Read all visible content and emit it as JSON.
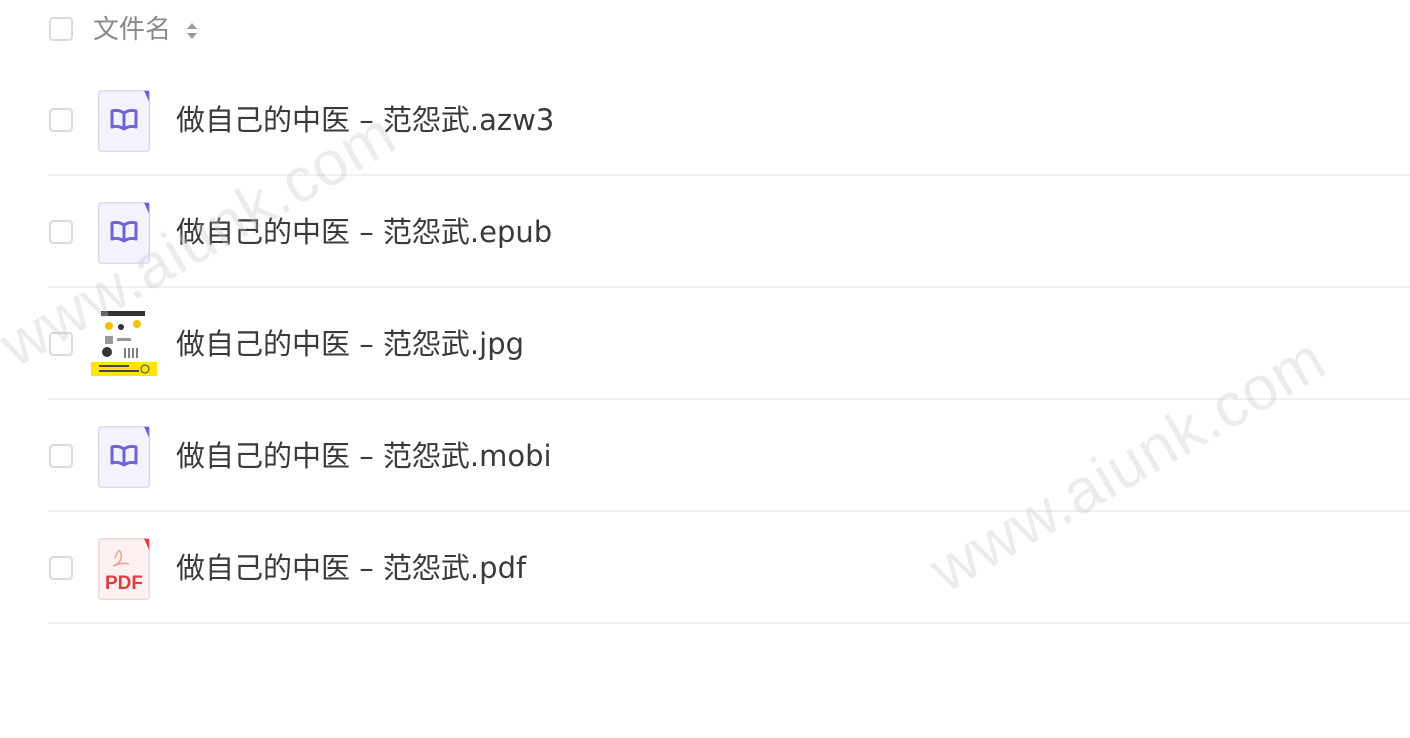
{
  "header": {
    "column_label": "文件名"
  },
  "files": [
    {
      "name": "做自己的中医 – 范怨武.azw3",
      "icon": "ebook-icon"
    },
    {
      "name": "做自己的中医 – 范怨武.epub",
      "icon": "ebook-icon"
    },
    {
      "name": "做自己的中医 – 范怨武.jpg",
      "icon": "image-thumbnail"
    },
    {
      "name": "做自己的中医 – 范怨武.mobi",
      "icon": "ebook-icon"
    },
    {
      "name": "做自己的中医 – 范怨武.pdf",
      "icon": "pdf-icon",
      "icon_text": "PDF"
    }
  ],
  "watermark": "www.aiunk.com",
  "colors": {
    "ebook_accent": "#6d63d6",
    "ebook_bg": "#f4f3fd",
    "pdf_accent": "#e13b3b",
    "pdf_bg": "#fdf1f1",
    "thumb_yellow": "#ffe600"
  }
}
